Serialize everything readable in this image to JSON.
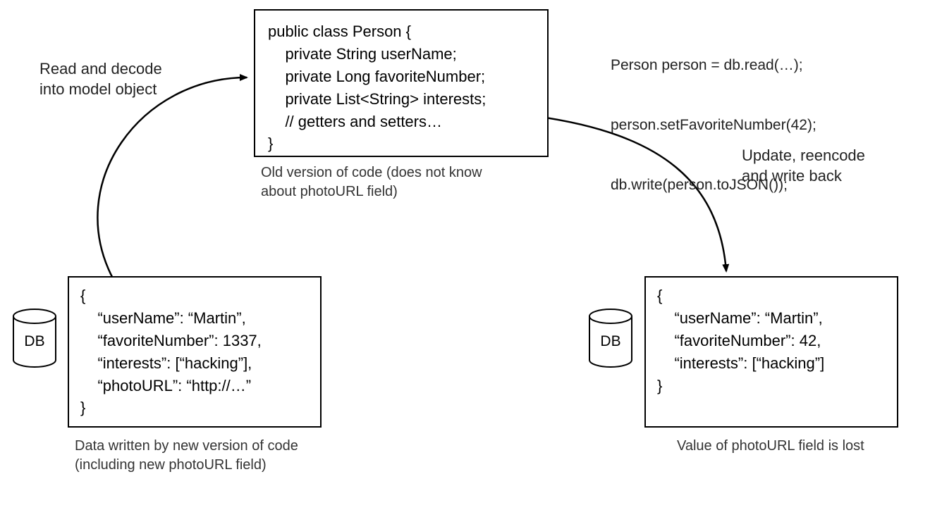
{
  "labels": {
    "read_decode": "Read and decode\ninto model object",
    "update_write": "Update, reencode\nand write back"
  },
  "code_box": {
    "line1": "public class Person {",
    "line2": "    private String userName;",
    "line3": "    private Long favoriteNumber;",
    "line4": "    private List<String> interests;",
    "line5": "    // getters and setters…",
    "line6": "}"
  },
  "snippet": {
    "line1": "Person person = db.read(…);",
    "line2": "person.setFavoriteNumber(42);",
    "line3": "db.write(person.toJSON());"
  },
  "json_left": {
    "line1": "{",
    "line2": "    “userName”: “Martin”,",
    "line3": "    “favoriteNumber”: 1337,",
    "line4": "    “interests”: [“hacking”],",
    "line5": "    “photoURL”: “http://…”",
    "line6": "}"
  },
  "json_right": {
    "line1": "{",
    "line2": "    “userName”: “Martin”,",
    "line3": "    “favoriteNumber”: 42,",
    "line4": "    “interests”: [“hacking”]",
    "line5": "}"
  },
  "captions": {
    "code_box": "Old version of code (does not know\nabout photoURL field)",
    "json_left": "Data written by new version of code\n(including new photoURL field)",
    "json_right": "Value of photoURL field is lost"
  },
  "db_label": "DB"
}
